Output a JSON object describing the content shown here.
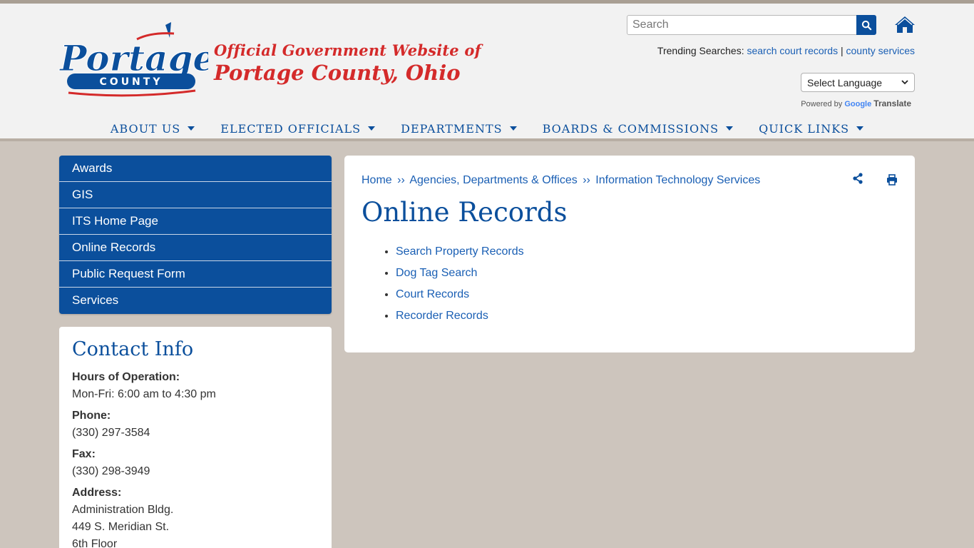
{
  "header": {
    "logo_text": "Portage",
    "logo_sub": "COUNTY",
    "tagline_line1": "Official Government Website of",
    "tagline_line2": "Portage County, Ohio",
    "search_placeholder": "Search",
    "trending_label": "Trending Searches:",
    "trending_links": [
      "search court records",
      "county services"
    ],
    "trending_separator": "|",
    "language_select": "Select Language",
    "powered_by": "Powered by",
    "google": "Google",
    "translate": "Translate"
  },
  "nav": [
    {
      "label": "ABOUT US"
    },
    {
      "label": "ELECTED OFFICIALS"
    },
    {
      "label": "DEPARTMENTS"
    },
    {
      "label": "BOARDS & COMMISSIONS"
    },
    {
      "label": "QUICK LINKS"
    }
  ],
  "side_menu": [
    {
      "label": "Awards"
    },
    {
      "label": "GIS"
    },
    {
      "label": "ITS Home Page"
    },
    {
      "label": "Online Records"
    },
    {
      "label": "Public Request Form"
    },
    {
      "label": "Services"
    }
  ],
  "contact": {
    "title": "Contact Info",
    "hours_label": "Hours of Operation:",
    "hours_value": "Mon-Fri: 6:00 am to 4:30 pm",
    "phone_label": "Phone:",
    "phone_value": "(330) 297-3584",
    "fax_label": "Fax:",
    "fax_value": "(330) 298-3949",
    "address_label": "Address:",
    "address_line1": "Administration Bldg.",
    "address_line2": "449 S. Meridian St.",
    "address_line3": "6th Floor"
  },
  "main": {
    "breadcrumb": [
      "Home",
      "Agencies, Departments & Offices",
      "Information Technology Services"
    ],
    "breadcrumb_sep": "››",
    "title": "Online Records",
    "records": [
      {
        "label": "Search Property Records"
      },
      {
        "label": "Dog Tag Search"
      },
      {
        "label": "Court Records"
      },
      {
        "label": "Recorder Records"
      }
    ]
  },
  "colors": {
    "brand_blue": "#0b4f9c",
    "link_blue": "#1a5fb4",
    "tagline_red": "#d42a2a",
    "page_bg": "#cdc5bd"
  }
}
